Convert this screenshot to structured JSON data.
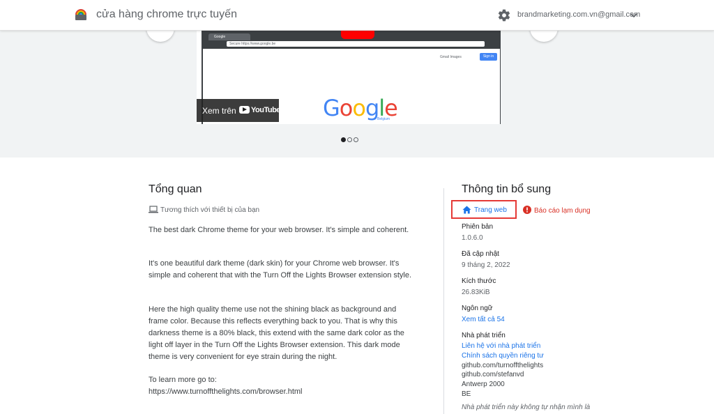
{
  "header": {
    "title": "cửa hàng chrome trực tuyến",
    "account": "brandmarketing.com.vn@gmail.com"
  },
  "hero": {
    "browser_tab": "Google",
    "omnibox": "Secure  https://www.google.be",
    "google_links": "Gmail   Images",
    "google_signin": "Sign in",
    "google_logo": "Google",
    "google_region": "Belgium",
    "watch_on": "Xem trên",
    "youtube": "YouTube",
    "active_slide": 1,
    "total_slides": 3
  },
  "overview": {
    "title": "Tổng quan",
    "compat": "Tương thích với thiết bị của bạn",
    "paragraphs": [
      "The best dark Chrome theme for your web browser. It's simple and coherent.",
      "It's one beautiful dark theme (dark skin) for your Chrome web browser. It's simple and coherent that with the Turn Off the Lights Browser extension style.",
      "Here the high quality theme use not the shining black as background and frame color. Because this reflects everything back to you. That is why this darkness theme is a 80% black, this extend with the same dark color as the light off layer in the Turn Off the Lights Browser extension. This dark mode theme is very convenient for eye strain during the night.",
      "To learn more go to:",
      "https://www.turnoffthelights.com/browser.html"
    ]
  },
  "additional": {
    "title": "Thông tin bổ sung",
    "website_btn": "Trang web",
    "report": "Báo cáo lạm dụng",
    "version_label": "Phiên bản",
    "version": "1.0.6.0",
    "updated_label": "Đã cập nhật",
    "updated": "9 tháng 2, 2022",
    "size_label": "Kích thước",
    "size": "26.83KiB",
    "lang_label": "Ngôn ngữ",
    "lang_link": "Xem tất cả 54",
    "dev_label": "Nhà phát triển",
    "dev_contact": "Liên hệ với nhà phát triển",
    "privacy": "Chính sách quyền riêng tư",
    "dev_line1": "github.com/turnoffthelights",
    "dev_line2": "github.com/stefanvd",
    "dev_line3": "Antwerp 2000",
    "dev_line4": "BE",
    "dev_note": "Nhà phát triển này không tự nhận mình là"
  },
  "colors": {
    "link": "#1a73e8",
    "report": "#d93025",
    "highlight": "#e53935",
    "hero_bg": "#f1f3f4"
  }
}
